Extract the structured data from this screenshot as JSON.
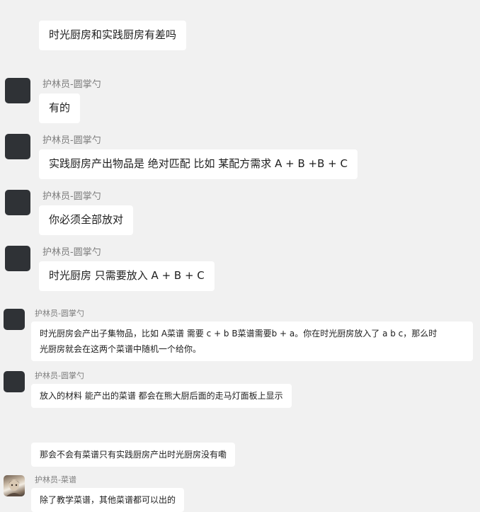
{
  "messages": [
    {
      "text": "时光厨房和实践厨房有差吗"
    },
    {
      "sender": "护林员-圆掌勺",
      "text": "有的"
    },
    {
      "sender": "护林员-圆掌勺",
      "text": "实践厨房产出物品是 绝对匹配 比如 某配方需求 A + B +B + C"
    },
    {
      "sender": "护林员-圆掌勺",
      "text": "你必须全部放对"
    },
    {
      "sender": "护林员-圆掌勺",
      "text": "时光厨房 只需要放入 A + B + C"
    },
    {
      "sender": "护林员-圆掌勺",
      "line1": "时光厨房会产出子集物品，比如 A菜谱 需要 c + b  B菜谱需要b + a。你在时光厨房放入了 a b c，那么时",
      "line2": "光厨房就会在这两个菜谱中随机一个给你。"
    },
    {
      "sender": "护林员-圆掌勺",
      "text": "放入的材料 能产出的菜谱 都会在熊大厨后面的走马灯面板上显示"
    },
    {
      "text": "那会不会有菜谱只有实践厨房产出时光厨房没有嘞"
    },
    {
      "sender": "护林员-菜谱",
      "text": "除了教学菜谱，其他菜谱都可以出的"
    }
  ],
  "avatars": {
    "default": "dark-square-avatar",
    "photo": "portrait-photo-avatar"
  }
}
